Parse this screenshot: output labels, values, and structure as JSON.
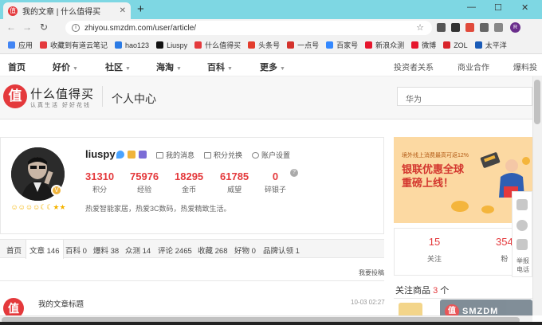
{
  "browser": {
    "tab_title": "我的文章 | 什么值得买",
    "tab_favicon": "值",
    "url": "zhiyou.smzdm.com/user/article/",
    "profile_initial": "R",
    "window_controls": {
      "minimize": "—",
      "maximize": "☐",
      "close": "✕"
    },
    "new_tab": "+",
    "back": "←",
    "forward": "→",
    "reload": "↻",
    "star": "☆"
  },
  "bookmarks": [
    {
      "label": "应用",
      "icon": "apps-icon",
      "color": "#4285f4"
    },
    {
      "label": "收藏到有道云笔记",
      "icon": "youdao-icon",
      "color": "#e4393c"
    },
    {
      "label": "hao123",
      "icon": "hao123-icon",
      "color": "#2b7be5"
    },
    {
      "label": "Liuspy",
      "icon": "windows-icon",
      "color": "#111111"
    },
    {
      "label": "什么值得买",
      "icon": "smzdm-icon",
      "color": "#e4393c"
    },
    {
      "label": "头条号",
      "icon": "toutiao-icon",
      "color": "#e33c2c"
    },
    {
      "label": "一点号",
      "icon": "yidian-icon",
      "color": "#d4322c"
    },
    {
      "label": "百家号",
      "icon": "baijia-icon",
      "color": "#3388ff"
    },
    {
      "label": "新浪众测",
      "icon": "sina-icon",
      "color": "#e6162d"
    },
    {
      "label": "微博",
      "icon": "weibo-icon",
      "color": "#e6162d"
    },
    {
      "label": "ZOL",
      "icon": "zol-icon",
      "color": "#d8232a"
    },
    {
      "label": "太平洋",
      "icon": "pconline-icon",
      "color": "#1a5bb7"
    }
  ],
  "site_nav": {
    "items": [
      "首页",
      "好价",
      "社区",
      "海淘",
      "百科",
      "更多"
    ],
    "right": [
      "投资者关系",
      "商业合作",
      "爆料投"
    ]
  },
  "header": {
    "logo_char": "值",
    "logo_text": "什么值得买",
    "logo_sub": "认真生活 好好花钱",
    "center_title": "个人中心",
    "search_placeholder": "华为"
  },
  "profile": {
    "username": "liuspy",
    "links": [
      "我的消息",
      "积分兑换",
      "账户设置"
    ],
    "stats": [
      {
        "value": "31310",
        "label": "积分"
      },
      {
        "value": "75976",
        "label": "经验"
      },
      {
        "value": "18295",
        "label": "金币"
      },
      {
        "value": "61785",
        "label": "威望"
      },
      {
        "value": "0",
        "label": "碎银子"
      }
    ],
    "help": "?",
    "bio": "热爱智能家居，热爱3C数码，热爱精致生活。",
    "level_badge": "V",
    "level_icons": "☺☺☺☺☾☾★★"
  },
  "banner": {
    "line1": "境外线上消费最高可返12%",
    "line2": "银联优惠全球",
    "line3": "重磅上线！"
  },
  "content_tabs": [
    {
      "label": "首页",
      "active": false
    },
    {
      "label": "文章 146",
      "active": true
    },
    {
      "label": "百科 0",
      "active": false
    },
    {
      "label": "爆料 38",
      "active": false
    },
    {
      "label": "众测 14",
      "active": false
    },
    {
      "label": "评论 2465",
      "active": false
    },
    {
      "label": "收藏 268",
      "active": false
    },
    {
      "label": "好物 0",
      "active": false
    },
    {
      "label": "品牌认领 1",
      "active": false
    }
  ],
  "submit_link": "我要投稿",
  "article": {
    "icon": "值",
    "title": "我的文章标题",
    "time": "10-03 02:27"
  },
  "follow": {
    "following_count": "15",
    "following_label": "关注",
    "fans_count": "354",
    "fans_label": "粉",
    "goods_title": "关注商品",
    "goods_count": "3",
    "goods_unit": "个"
  },
  "watermark": {
    "char": "值",
    "text": "SMZDM"
  },
  "side_tools": {
    "label": "举报\n电话"
  }
}
